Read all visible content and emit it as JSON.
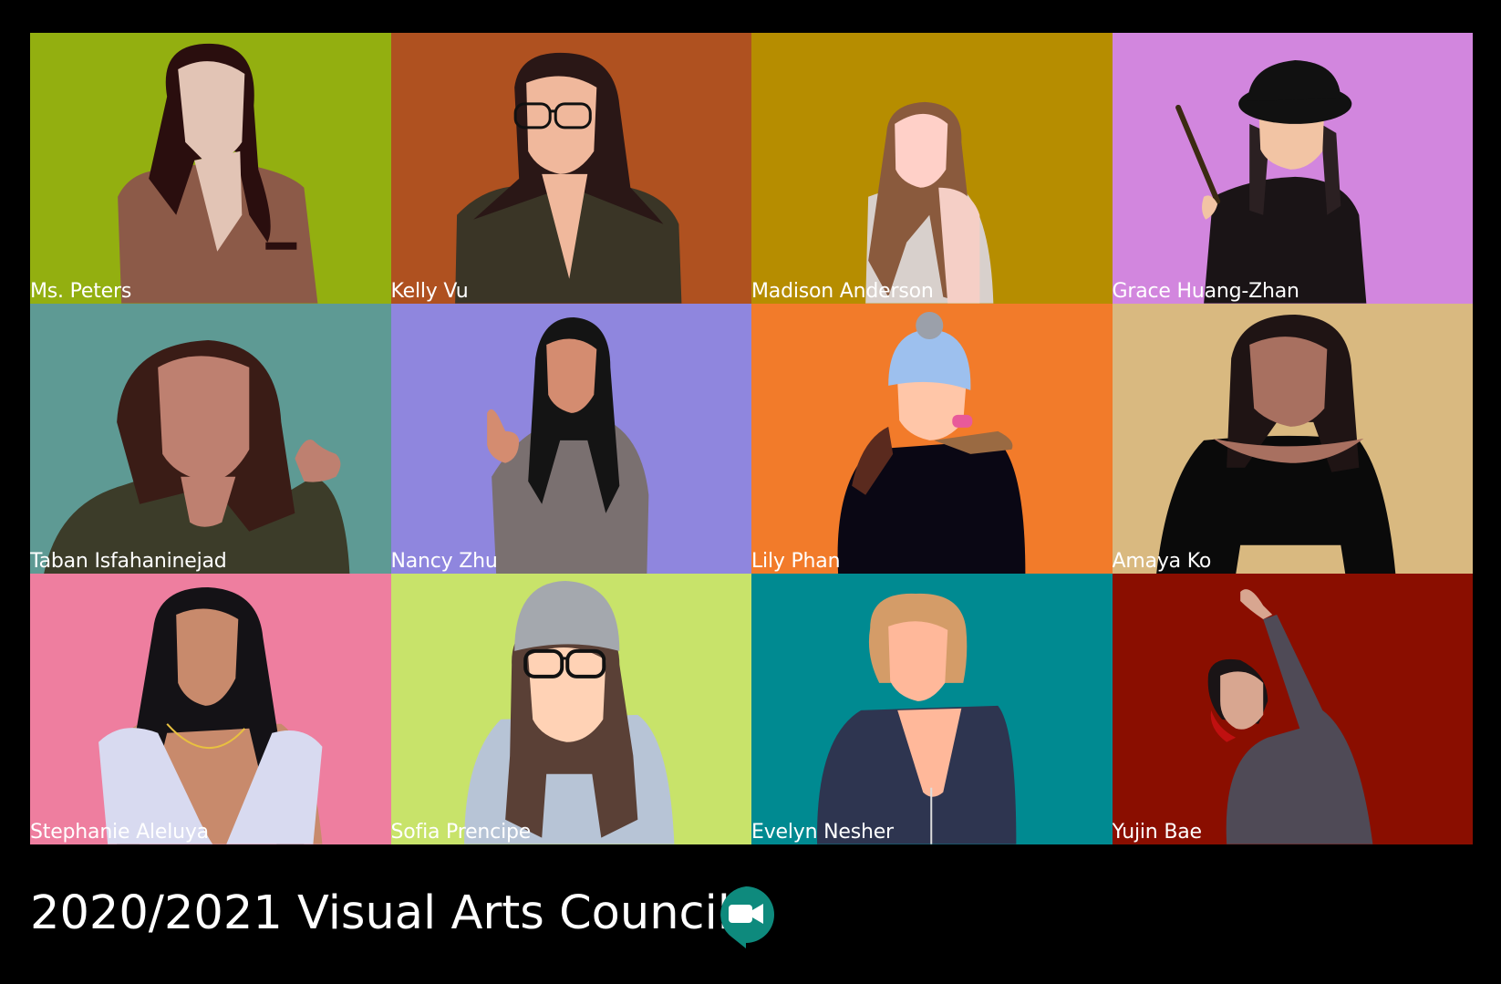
{
  "meeting": {
    "title": "2020/2021 Visual Arts Council",
    "app_icon": "google-meet-icon",
    "app_icon_color": "#0E8A7D"
  },
  "participants": [
    {
      "name": "Ms. Peters",
      "bg": "#93AF10"
    },
    {
      "name": "Kelly Vu",
      "bg": "#AF5120"
    },
    {
      "name": "Madison Anderson",
      "bg": "#B68D00"
    },
    {
      "name": "Grace Huang-Zhan",
      "bg": "#D286DE"
    },
    {
      "name": "Taban Isfahaninejad",
      "bg": "#5E9A94"
    },
    {
      "name": "Nancy Zhu",
      "bg": "#8F86DE"
    },
    {
      "name": "Lily Phan",
      "bg": "#F27B2A"
    },
    {
      "name": "Amaya Ko",
      "bg": "#D9B980"
    },
    {
      "name": "Stephanie Aleluya",
      "bg": "#EE7E9F"
    },
    {
      "name": "Sofia Prencipe",
      "bg": "#C8E36A"
    },
    {
      "name": "Evelyn Nesher",
      "bg": "#008A91"
    },
    {
      "name": "Yujin Bae",
      "bg": "#8A0E00"
    }
  ]
}
